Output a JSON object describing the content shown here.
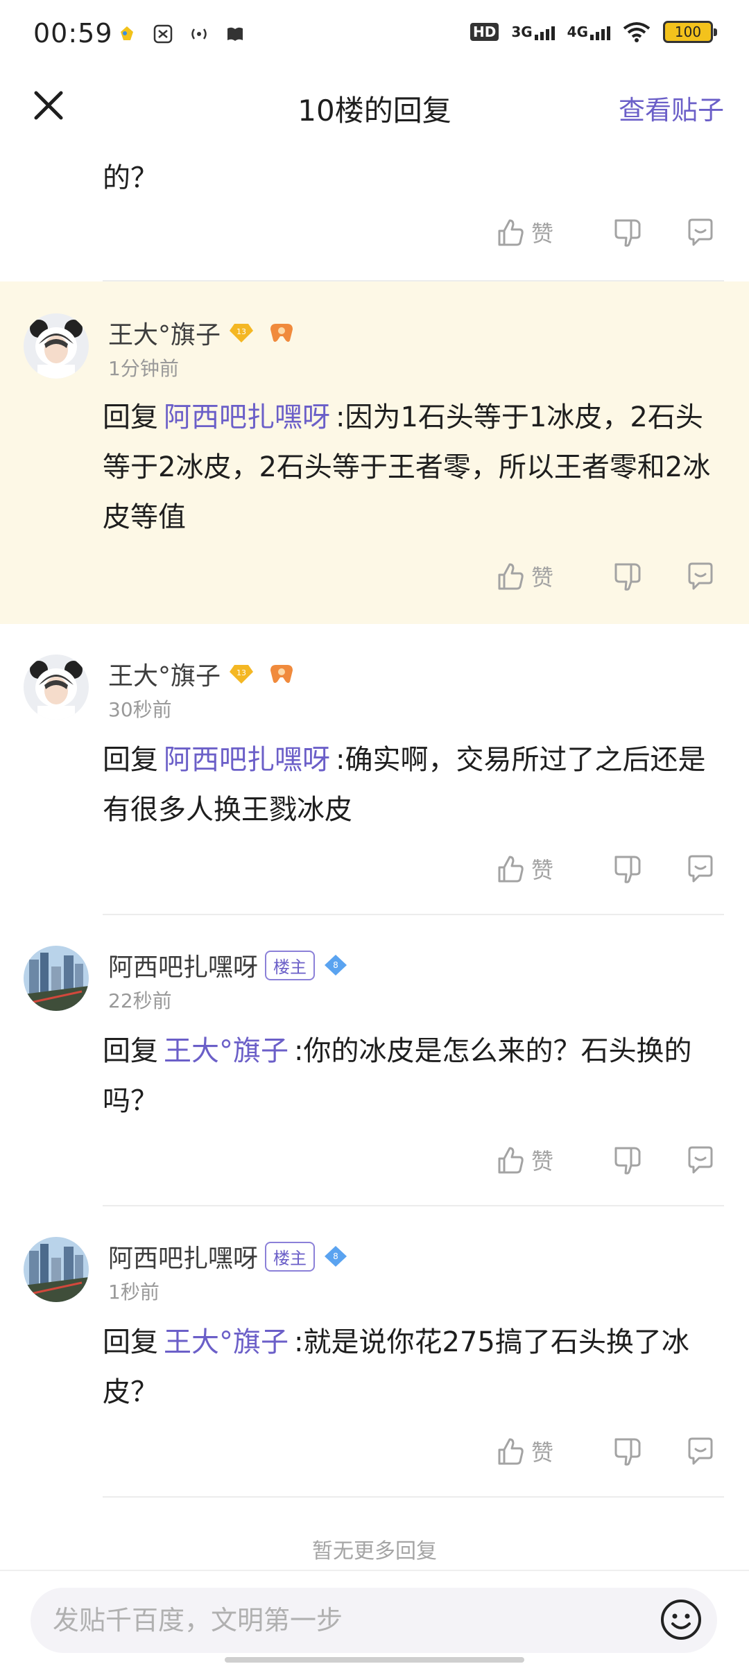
{
  "status_bar": {
    "time": "00:59",
    "network_1": "3G",
    "network_2": "4G",
    "hd_label": "HD",
    "battery": "100"
  },
  "header": {
    "title": "10楼的回复",
    "view_post": "查看贴子"
  },
  "top_fragment": "的？",
  "like_label": "赞",
  "replies": [
    {
      "username": "王大°旗子",
      "level": "13",
      "time": "1分钟前",
      "reply_prefix": "回复",
      "mention": "阿西吧扎嘿呀",
      "text": ":因为1石头等于1冰皮，2石头等于2冰皮，2石头等于王者零，所以王者零和2冰皮等值"
    },
    {
      "username": "王大°旗子",
      "level": "13",
      "time": "30秒前",
      "reply_prefix": "回复",
      "mention": "阿西吧扎嘿呀",
      "text": ":确实啊，交易所过了之后还是有很多人换王戮冰皮"
    },
    {
      "username": "阿西吧扎嘿呀",
      "owner_tag": "楼主",
      "level": "8",
      "time": "22秒前",
      "reply_prefix": "回复",
      "mention": "王大°旗子",
      "text": ":你的冰皮是怎么来的？石头换的吗？"
    },
    {
      "username": "阿西吧扎嘿呀",
      "owner_tag": "楼主",
      "level": "8",
      "time": "1秒前",
      "reply_prefix": "回复",
      "mention": "王大°旗子",
      "text": ":就是说你花275搞了石头换了冰皮？"
    }
  ],
  "no_more": "暂无更多回复",
  "compose": {
    "placeholder": "发贴千百度，文明第一步"
  },
  "colors": {
    "accent": "#6b5fc8",
    "highlight_bg": "#fdf8e6",
    "gold_badge": "#f4b724",
    "blue_badge": "#5aa3f0"
  }
}
